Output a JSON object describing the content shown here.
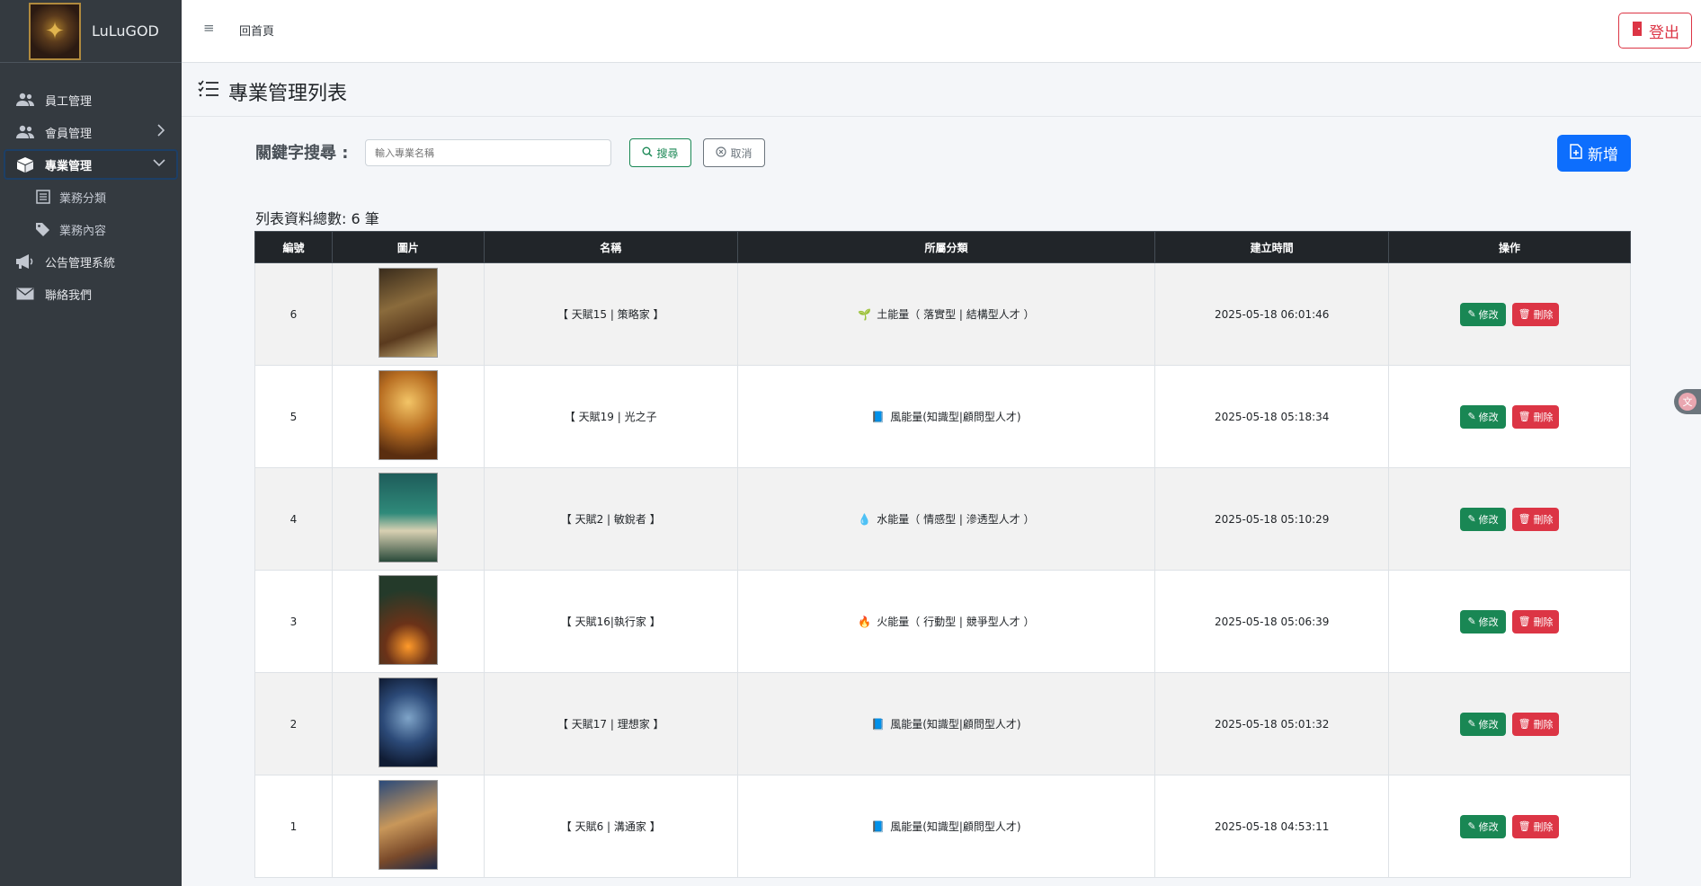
{
  "brand": {
    "name": "LuLuGOD"
  },
  "sidebar": {
    "items": [
      {
        "label": "員工管理",
        "icon": "users-icon"
      },
      {
        "label": "會員管理",
        "icon": "users-icon"
      },
      {
        "label": "專業管理",
        "icon": "box-icon"
      },
      {
        "label": "業務分類",
        "icon": "list-icon"
      },
      {
        "label": "業務內容",
        "icon": "tags-icon"
      },
      {
        "label": "公告管理系統",
        "icon": "megaphone-icon"
      },
      {
        "label": "聯絡我們",
        "icon": "envelope-icon"
      }
    ]
  },
  "topbar": {
    "home": "回首頁",
    "logout": "登出"
  },
  "page": {
    "title": "專業管理列表"
  },
  "search": {
    "label": "關鍵字搜尋 :",
    "placeholder": "輸入專業名稱",
    "search_button": "搜尋",
    "cancel_button": "取消"
  },
  "add_button": "新增",
  "total_text": "列表資料總數: 6 筆",
  "table": {
    "columns": [
      "編號",
      "圖片",
      "名稱",
      "所屬分類",
      "建立時間",
      "操作"
    ],
    "rows": [
      {
        "id": "6",
        "name": "【 天賦15 | 策略家 】",
        "emoji": "🌱",
        "category": "土能量（ 落實型 | 結構型人才 ）",
        "created": "2025-05-18 06:01:46"
      },
      {
        "id": "5",
        "name": "【 天賦19 | 光之子",
        "emoji": "📘",
        "category": "風能量(知識型|顧問型人才)",
        "created": "2025-05-18 05:18:34"
      },
      {
        "id": "4",
        "name": "【 天賦2 | 敏銳者 】",
        "emoji": "💧",
        "category": "水能量（ 情感型 | 滲透型人才 ）",
        "created": "2025-05-18 05:10:29"
      },
      {
        "id": "3",
        "name": "【 天賦16|執行家 】",
        "emoji": "🔥",
        "category": "火能量（ 行動型 | 競爭型人才 ）",
        "created": "2025-05-18 05:06:39"
      },
      {
        "id": "2",
        "name": "【 天賦17 | 理想家 】",
        "emoji": "📘",
        "category": "風能量(知識型|顧問型人才)",
        "created": "2025-05-18 05:01:32"
      },
      {
        "id": "1",
        "name": "【 天賦6 | 溝通家 】",
        "emoji": "📘",
        "category": "風能量(知識型|顧問型人才)",
        "created": "2025-05-18 04:53:11"
      }
    ],
    "edit_label": "修改",
    "delete_label": "刪除"
  }
}
